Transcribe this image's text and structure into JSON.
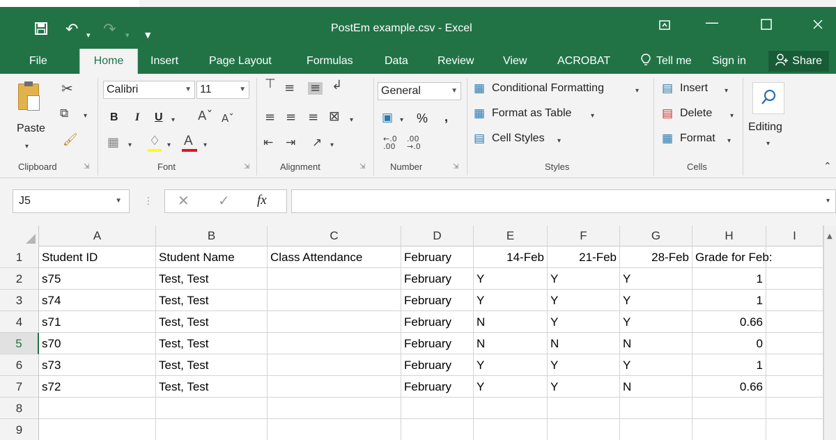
{
  "window": {
    "title": "PostEm example.csv - Excel",
    "colors": {
      "accent": "#217346",
      "ribbon_bg": "#f3f3f3",
      "share_bg": "#185c37"
    }
  },
  "tabs": [
    {
      "label": "File"
    },
    {
      "label": "Home",
      "active": true
    },
    {
      "label": "Insert"
    },
    {
      "label": "Page Layout"
    },
    {
      "label": "Formulas"
    },
    {
      "label": "Data"
    },
    {
      "label": "Review"
    },
    {
      "label": "View"
    },
    {
      "label": "ACROBAT"
    }
  ],
  "tellme": {
    "label": "Tell me"
  },
  "signin": {
    "label": "Sign in"
  },
  "share": {
    "label": "Share"
  },
  "ribbon": {
    "clipboard": {
      "group_label": "Clipboard",
      "paste_label": "Paste"
    },
    "font": {
      "group_label": "Font",
      "font_name": "Calibri",
      "font_size": "11",
      "bold": "B",
      "italic": "I",
      "underline": "U"
    },
    "alignment": {
      "group_label": "Alignment"
    },
    "number": {
      "group_label": "Number",
      "format": "General",
      "percent": "%",
      "comma": ","
    },
    "styles": {
      "group_label": "Styles",
      "conditional_formatting": "Conditional Formatting",
      "format_as_table": "Format as Table",
      "cell_styles": "Cell Styles"
    },
    "cells": {
      "group_label": "Cells",
      "insert": "Insert",
      "delete": "Delete",
      "format": "Format"
    },
    "editing": {
      "label": "Editing"
    }
  },
  "formula_bar": {
    "name_box": "J5",
    "fx": "fx",
    "value": ""
  },
  "sheet": {
    "columns": [
      "A",
      "B",
      "C",
      "D",
      "E",
      "F",
      "G",
      "H",
      "I"
    ],
    "row_numbers": [
      "1",
      "2",
      "3",
      "4",
      "5",
      "6",
      "7",
      "8",
      "9"
    ],
    "selected_row": "5",
    "rows": [
      [
        "Student ID",
        "Student Name",
        "Class Attendance",
        "February",
        "14-Feb",
        "21-Feb",
        "28-Feb",
        "Grade for Feb:",
        ""
      ],
      [
        "s75",
        "Test, Test",
        "",
        "February",
        "Y",
        "Y",
        "Y",
        "1",
        ""
      ],
      [
        "s74",
        "Test, Test",
        "",
        "February",
        "Y",
        "Y",
        "Y",
        "1",
        ""
      ],
      [
        "s71",
        "Test, Test",
        "",
        "February",
        "N",
        "Y",
        "Y",
        "0.66",
        ""
      ],
      [
        "s70",
        "Test, Test",
        "",
        "February",
        "N",
        "N",
        "N",
        "0",
        ""
      ],
      [
        "s73",
        "Test, Test",
        "",
        "February",
        "Y",
        "Y",
        "Y",
        "1",
        ""
      ],
      [
        "s72",
        "Test, Test",
        "",
        "February",
        "Y",
        "Y",
        "N",
        "0.66",
        ""
      ],
      [
        "",
        "",
        "",
        "",
        "",
        "",
        "",
        "",
        ""
      ],
      [
        "",
        "",
        "",
        "",
        "",
        "",
        "",
        "",
        ""
      ]
    ]
  }
}
